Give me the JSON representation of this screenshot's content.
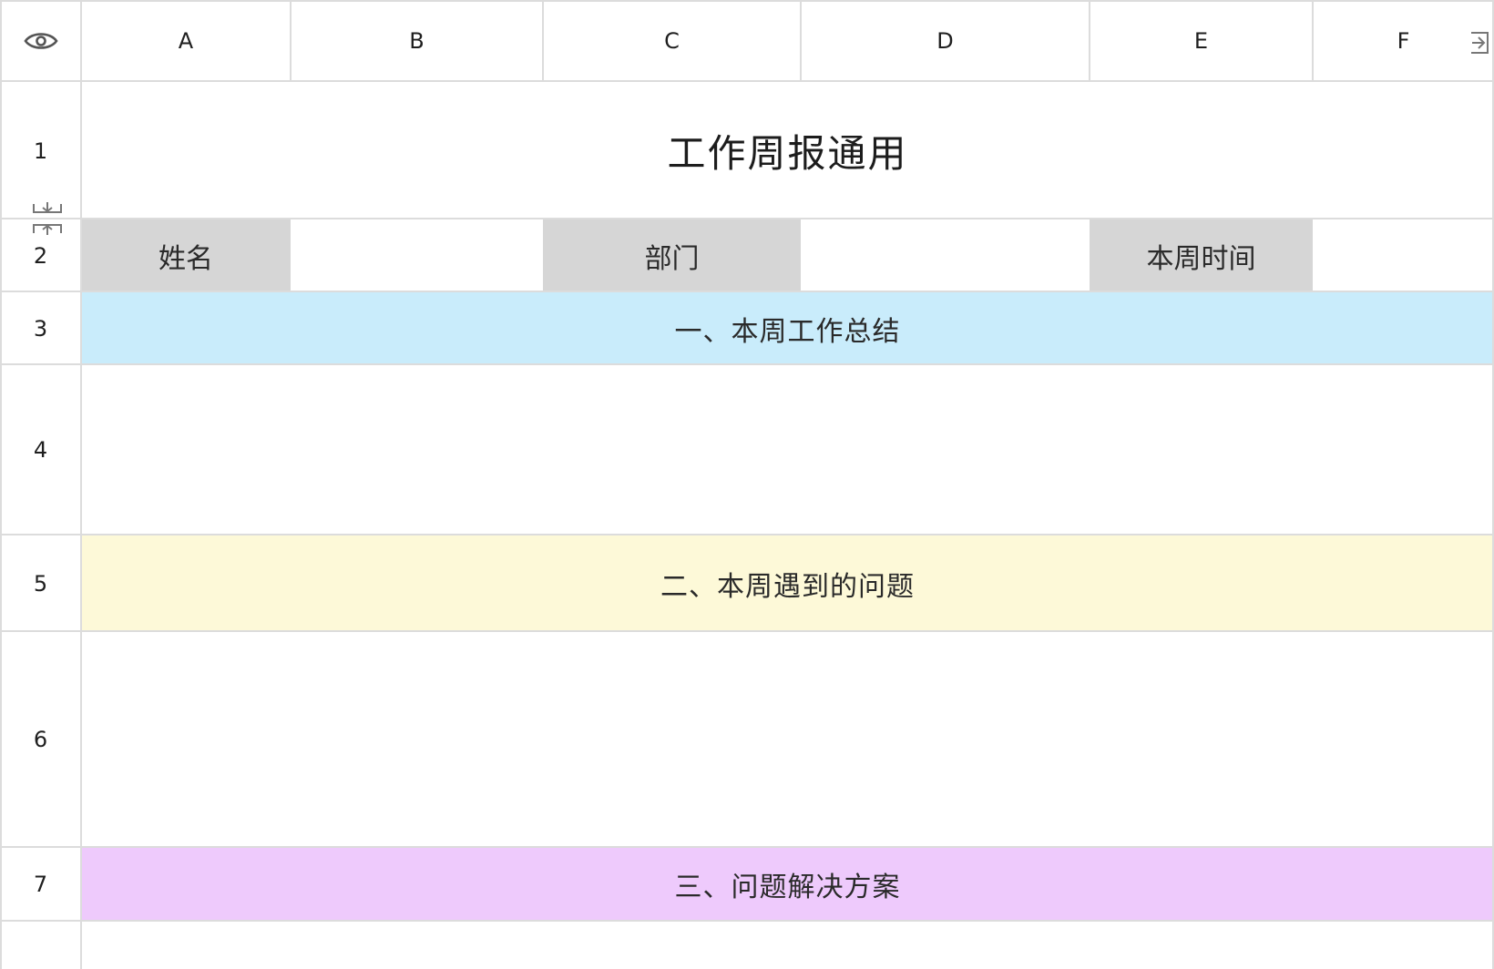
{
  "header": {
    "toggle_icon": "eye-icon",
    "columns": [
      "A",
      "B",
      "C",
      "D",
      "E",
      "F"
    ],
    "scroll_icon": "arrow-right-icon"
  },
  "rows": [
    "1",
    "2",
    "3",
    "4",
    "5",
    "6",
    "7"
  ],
  "resize_icon": "row-resize-icon",
  "title": "工作周报通用",
  "info_row": {
    "name_label": "姓名",
    "name_value": "",
    "dept_label": "部门",
    "dept_value": "",
    "time_label": "本周时间",
    "time_value": ""
  },
  "sections": {
    "summary": "一、本周工作总结",
    "summary_content": "",
    "problems": "二、本周遇到的问题",
    "problems_content": "",
    "solutions": "三、问题解决方案"
  },
  "colors": {
    "header_gray": "#d6d6d6",
    "summary_blue": "#c9ecfb",
    "problems_yellow": "#fdf9d8",
    "solutions_purple": "#eecafc",
    "gridline": "#dcdcdc"
  }
}
